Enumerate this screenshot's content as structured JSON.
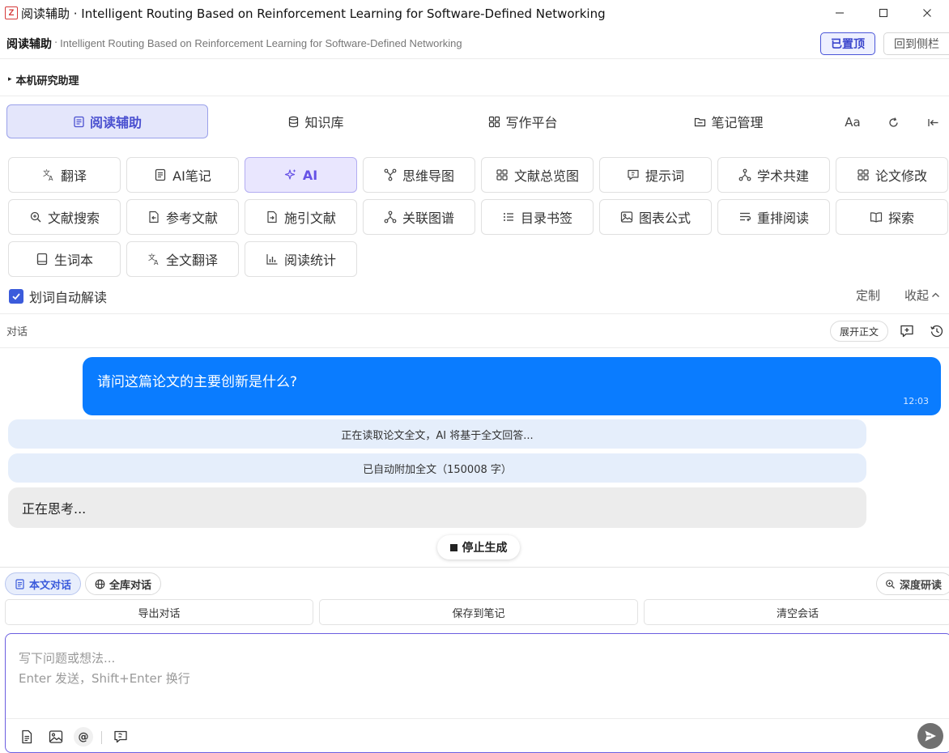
{
  "window": {
    "app_logo": "Z",
    "title": "阅读辅助 · Intelligent Routing Based on Reinforcement Learning for Software-Defined Networking",
    "controls": [
      "minimize-icon",
      "maximize-icon",
      "close-icon"
    ]
  },
  "header": {
    "label": "阅读辅助",
    "separator": "·",
    "paper_title": "Intelligent Routing Based on Reinforcement Learning for Software-Defined Networking",
    "pin_label": "已置顶",
    "back_label": "回到侧栏"
  },
  "section": {
    "caret": "▸",
    "title": "本机研究助理"
  },
  "main_nav": {
    "tabs": [
      {
        "label": "阅读辅助",
        "icon": "document-icon",
        "active": true
      },
      {
        "label": "知识库",
        "icon": "database-icon",
        "active": false
      },
      {
        "label": "写作平台",
        "icon": "grid-icon",
        "active": false
      },
      {
        "label": "笔记管理",
        "icon": "folder-icon",
        "active": false
      }
    ],
    "font_size_label": "Aa",
    "tools": [
      "refresh-icon",
      "collapse-left-icon"
    ]
  },
  "tools": {
    "row1": [
      {
        "label": "翻译",
        "icon": "translate-icon"
      },
      {
        "label": "AI笔记",
        "icon": "note-icon"
      },
      {
        "label": "AI",
        "icon": "sparkle-icon",
        "active": true
      },
      {
        "label": "思维导图",
        "icon": "mindmap-icon"
      },
      {
        "label": "文献总览图",
        "icon": "grid-icon"
      },
      {
        "label": "提示词",
        "icon": "chat-icon"
      },
      {
        "label": "学术共建",
        "icon": "network-icon"
      },
      {
        "label": "论文修改",
        "icon": "grid-icon"
      }
    ],
    "row2": [
      {
        "label": "文献搜索",
        "icon": "search-icon"
      },
      {
        "label": "参考文献",
        "icon": "reference-icon"
      },
      {
        "label": "施引文献",
        "icon": "citing-icon"
      },
      {
        "label": "关联图谱",
        "icon": "graph-icon"
      },
      {
        "label": "目录书签",
        "icon": "list-icon"
      },
      {
        "label": "图表公式",
        "icon": "image-icon"
      },
      {
        "label": "重排阅读",
        "icon": "reflow-icon"
      },
      {
        "label": "探索",
        "icon": "book-icon"
      }
    ],
    "row3": [
      {
        "label": "生词本",
        "icon": "notebook-icon"
      },
      {
        "label": "全文翻译",
        "icon": "translate-icon"
      },
      {
        "label": "阅读统计",
        "icon": "bar-chart-icon"
      }
    ]
  },
  "auto_explain": {
    "checked": true,
    "label": "划词自动解读",
    "customize_label": "定制",
    "collapse_label": "收起"
  },
  "conversation": {
    "title": "对话",
    "expand_label": "展开正文",
    "icons": [
      "new-chat-icon",
      "history-icon"
    ]
  },
  "messages": {
    "user_text": "请问这篇论文的主要创新是什么?",
    "user_time": "12:03",
    "status1": "正在读取论文全文，AI 将基于全文回答...",
    "status2": "已自动附加全文（150008 字）",
    "thinking": "正在思考..."
  },
  "stop_label": "停止生成",
  "scope": {
    "paper_label": "本文对话",
    "library_label": "全库对话",
    "deep_label": "深度研读"
  },
  "actions": {
    "export": "导出对话",
    "save": "保存到笔记",
    "clear": "清空会话"
  },
  "input": {
    "placeholder": "写下问题或想法...\nEnter 发送，Shift+Enter 换行",
    "tools": [
      "file-icon",
      "image-icon",
      "mention-icon",
      "prompt-icon"
    ],
    "mention_glyph": "@",
    "send_icon": "send-icon"
  },
  "colors": {
    "accent": "#4a50d0",
    "user_bubble": "#0a7cff",
    "status_bg": "#e5eefb",
    "active_tool_bg": "#e9e6fe",
    "checkbox": "#3b5bdb"
  }
}
